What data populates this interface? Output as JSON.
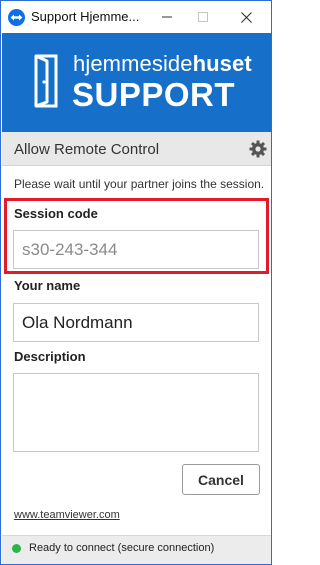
{
  "window": {
    "title": "Support Hjemme...",
    "accent_color": "#1670c9"
  },
  "banner": {
    "brand_light": "hjemmeside",
    "brand_bold": "huset",
    "brand_support": "SUPPORT"
  },
  "section": {
    "title": "Allow Remote Control",
    "settings_icon": "gear-icon"
  },
  "wait_message": "Please wait until your partner joins the session.",
  "session_code": {
    "label": "Session code",
    "placeholder": "s30-243-344",
    "value": ""
  },
  "your_name": {
    "label": "Your name",
    "value": "Ola Nordmann"
  },
  "description": {
    "label": "Description",
    "value": ""
  },
  "buttons": {
    "cancel": "Cancel"
  },
  "footer": {
    "link": "www.teamviewer.com"
  },
  "status": {
    "text": "Ready to connect (secure connection)",
    "color": "#2fb34a"
  }
}
